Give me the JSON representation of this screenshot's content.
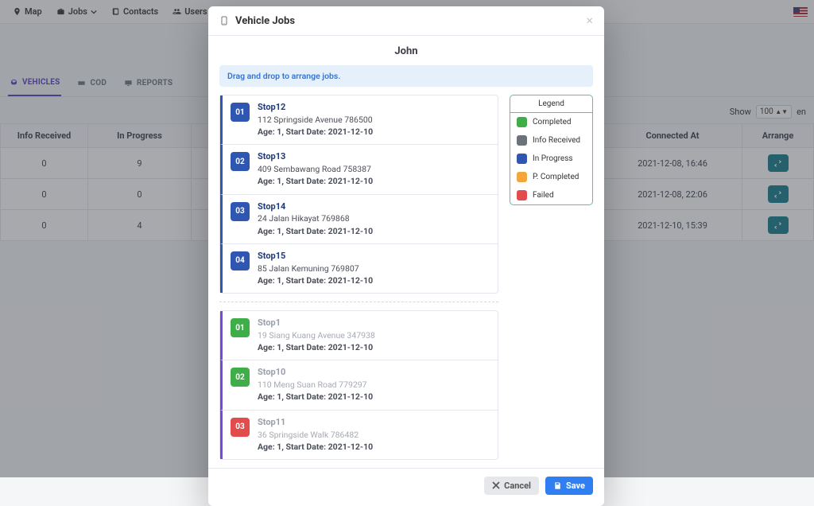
{
  "nav": {
    "items": [
      {
        "label": "Map"
      },
      {
        "label": "Jobs"
      },
      {
        "label": "Contacts"
      },
      {
        "label": "Users"
      },
      {
        "label": ""
      }
    ]
  },
  "tabs": {
    "vehicles": "VEHICLES",
    "cod": "COD",
    "reports": "REPORTS"
  },
  "listbar": {
    "show": "Show",
    "page_size": "100",
    "entries_trunc": "en"
  },
  "table": {
    "cols": {
      "info_received": "Info Received",
      "in_progress": "In Progress",
      "connected_at": "Connected At",
      "arrange": "Arrange"
    },
    "rows": [
      {
        "info_received": "0",
        "in_progress": "9",
        "connected_at": "2021-12-08, 16:46"
      },
      {
        "info_received": "0",
        "in_progress": "0",
        "connected_at": "2021-12-08, 22:06"
      },
      {
        "info_received": "0",
        "in_progress": "4",
        "connected_at": "2021-12-10, 15:39"
      }
    ]
  },
  "modal": {
    "title": "Vehicle Jobs",
    "name": "John",
    "info": "Drag and drop to arrange jobs.",
    "legend": {
      "title": "Legend",
      "items": [
        {
          "label": "Completed",
          "color": "#3fae49"
        },
        {
          "label": "Info Received",
          "color": "#6d717a"
        },
        {
          "label": "In Progress",
          "color": "#2f56b0"
        },
        {
          "label": "P. Completed",
          "color": "#f2a63b"
        },
        {
          "label": "Failed",
          "color": "#e24c4c"
        }
      ]
    },
    "group_blue": [
      {
        "num": "01",
        "title": "Stop12",
        "addr": "112 Springside Avenue 786500",
        "meta": "Age: 1, Start Date: 2021-12-10"
      },
      {
        "num": "02",
        "title": "Stop13",
        "addr": "409 Sembawang Road 758387",
        "meta": "Age: 1, Start Date: 2021-12-10"
      },
      {
        "num": "03",
        "title": "Stop14",
        "addr": "24 Jalan Hikayat 769868",
        "meta": "Age: 1, Start Date: 2021-12-10"
      },
      {
        "num": "04",
        "title": "Stop15",
        "addr": "85 Jalan Kemuning 769807",
        "meta": "Age: 1, Start Date: 2021-12-10"
      }
    ],
    "group_done": [
      {
        "num": "01",
        "sq": "green",
        "title": "Stop1",
        "addr": "19 Siang Kuang Avenue 347938",
        "meta": "Age: 1, Start Date: 2021-12-10"
      },
      {
        "num": "02",
        "sq": "green",
        "title": "Stop10",
        "addr": "110 Meng Suan Road 779297",
        "meta": "Age: 1, Start Date: 2021-12-10"
      },
      {
        "num": "03",
        "sq": "red",
        "title": "Stop11",
        "addr": "36 Springside Walk 786482",
        "meta": "Age: 1, Start Date: 2021-12-10"
      }
    ],
    "buttons": {
      "cancel": "Cancel",
      "save": "Save"
    }
  }
}
